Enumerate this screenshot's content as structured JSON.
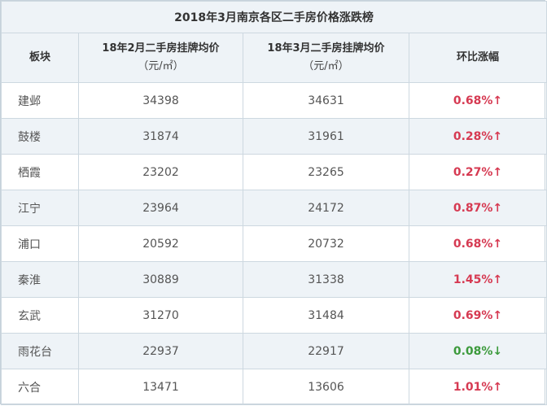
{
  "title": "2018年3月南京各区二手房价格涨跌榜",
  "headers": {
    "district": "板块",
    "feb_price": "18年2月二手房挂牌均价",
    "feb_unit": "（元/㎡）",
    "mar_price": "18年3月二手房挂牌均价",
    "mar_unit": "（元/㎡）",
    "change": "环比涨幅"
  },
  "colors": {
    "up": "#d63a52",
    "down": "#3c9a3c",
    "header_bg": "#eef3f7",
    "border": "#cdd8e0"
  },
  "rows": [
    {
      "district": "建邺",
      "feb": "34398",
      "mar": "34631",
      "change": "0.68%↑",
      "dir": "up"
    },
    {
      "district": "鼓楼",
      "feb": "31874",
      "mar": "31961",
      "change": "0.28%↑",
      "dir": "up"
    },
    {
      "district": "栖霞",
      "feb": "23202",
      "mar": "23265",
      "change": "0.27%↑",
      "dir": "up"
    },
    {
      "district": "江宁",
      "feb": "23964",
      "mar": "24172",
      "change": "0.87%↑",
      "dir": "up"
    },
    {
      "district": "浦口",
      "feb": "20592",
      "mar": "20732",
      "change": "0.68%↑",
      "dir": "up"
    },
    {
      "district": "秦淮",
      "feb": "30889",
      "mar": "31338",
      "change": "1.45%↑",
      "dir": "up"
    },
    {
      "district": "玄武",
      "feb": "31270",
      "mar": "31484",
      "change": "0.69%↑",
      "dir": "up"
    },
    {
      "district": "雨花台",
      "feb": "22937",
      "mar": "22917",
      "change": "0.08%↓",
      "dir": "down"
    },
    {
      "district": "六合",
      "feb": "13471",
      "mar": "13606",
      "change": "1.01%↑",
      "dir": "up"
    }
  ]
}
